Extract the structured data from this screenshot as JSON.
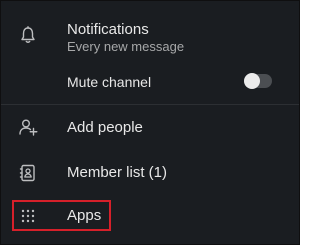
{
  "menu": {
    "notifications": {
      "label": "Notifications",
      "sublabel": "Every new message",
      "icon": "bell-icon"
    },
    "mute_channel": {
      "label": "Mute channel",
      "toggle_on": false
    },
    "add_people": {
      "label": "Add people",
      "icon": "add-person-icon"
    },
    "member_list": {
      "label": "Member list (1)",
      "icon": "member-list-icon"
    },
    "apps": {
      "label": "Apps",
      "icon": "apps-grid-icon"
    }
  },
  "colors": {
    "background": "#1a1d21",
    "text": "#e8e8e8",
    "subtext": "#a7a8a9",
    "highlight_border": "#d6202a",
    "toggle_track": "#4b4e52",
    "toggle_knob": "#ebebeb"
  }
}
